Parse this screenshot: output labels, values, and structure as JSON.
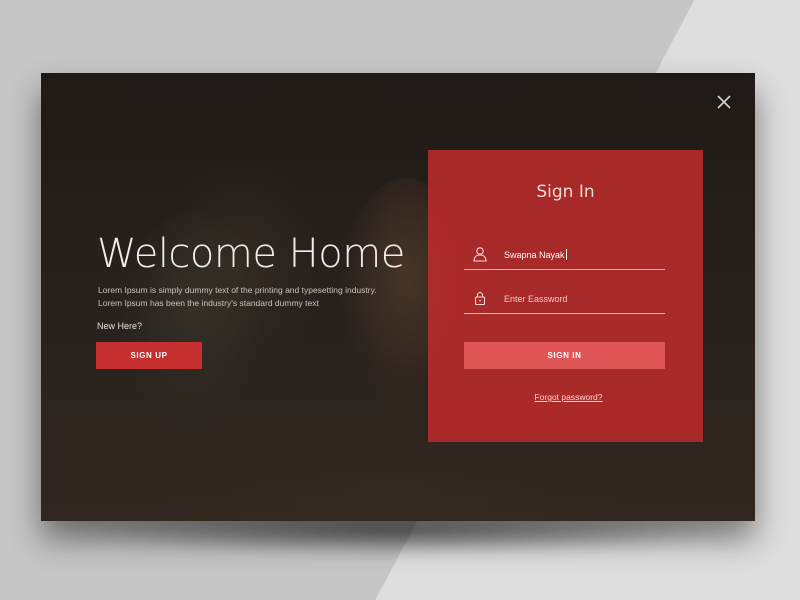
{
  "welcome": {
    "title": "Welcome Home",
    "description": "Lorem Ipsum is simply dummy text of the printing and typesetting industry. Lorem Ipsum has been the industry's standard dummy text",
    "new_here": "New Here?",
    "signup_label": "SIGN UP"
  },
  "signin": {
    "title": "Sign In",
    "username_value": "Swapna Nayak",
    "username_icon": "user-icon",
    "password_placeholder": "Enter Eassword",
    "password_icon": "lock-icon",
    "signin_label": "SIGN IN",
    "forgot_label": "Forgot password?"
  },
  "close_icon": "close-icon",
  "colors": {
    "accent": "#c62f2f",
    "panel": "#c42c2c",
    "signin_button": "#e05656"
  }
}
